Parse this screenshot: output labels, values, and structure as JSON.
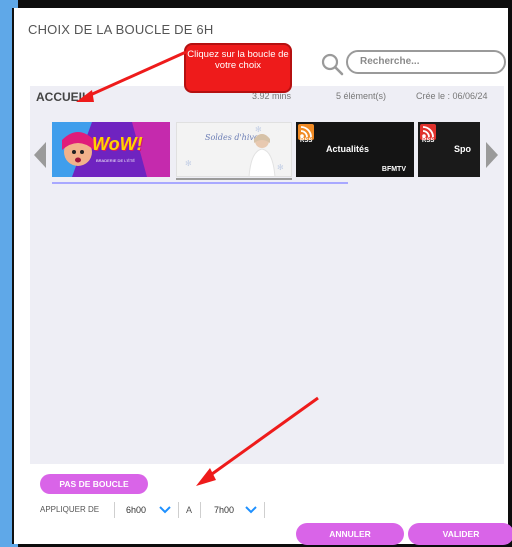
{
  "dialog": {
    "title": "CHOIX DE LA BOUCLE DE 6H"
  },
  "search": {
    "placeholder": "Recherche..."
  },
  "loop": {
    "name": "ACCUEIL",
    "duration": "3.92 mins",
    "count": "5 élément(s)",
    "created": "Crée le : 06/06/24"
  },
  "thumbnails": [
    {
      "kind": "image",
      "text": "WoW!",
      "subtext": "BRADERIE DE L'ÉTÉ"
    },
    {
      "kind": "image",
      "text": "Soldes d'hiver"
    },
    {
      "kind": "rss",
      "badge": "RSS",
      "title": "Actualités",
      "source": "BFMTV"
    },
    {
      "kind": "rss",
      "badge": "RSS",
      "title": "Spo"
    }
  ],
  "callout": {
    "text": "Cliquez sur la boucle de votre choix"
  },
  "controls": {
    "no_loop_label": "PAS DE BOUCLE",
    "apply_from_label": "APPLIQUER DE",
    "from_value": "6h00",
    "to_label": "A",
    "to_value": "7h00",
    "cancel_label": "ANNULER",
    "validate_label": "VALIDER"
  },
  "colors": {
    "accent": "#d964e8",
    "callout": "#ee1b1b",
    "panel": "#eeeef5",
    "chevron": "#1e90ff"
  },
  "icons": [
    "search-icon",
    "arrow-left-icon",
    "arrow-right-icon",
    "rss-icon",
    "chevron-down-icon"
  ]
}
